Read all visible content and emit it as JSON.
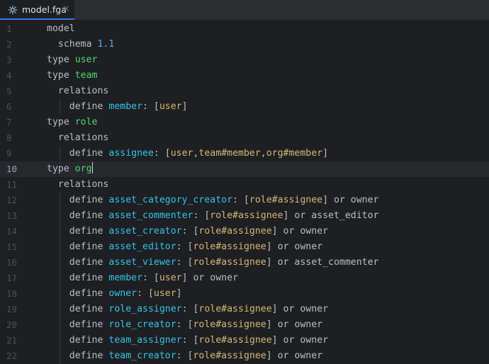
{
  "tab": {
    "label": "model.fga",
    "close": "×",
    "icon": "openfga-model-icon"
  },
  "editor": {
    "current_line": 10,
    "lines": [
      {
        "n": "1",
        "tokens": [
          [
            "kw",
            "model"
          ]
        ],
        "indent": 0
      },
      {
        "n": "2",
        "tokens": [
          [
            "kw",
            "schema "
          ],
          [
            "num",
            "1.1"
          ]
        ],
        "indent": 1
      },
      {
        "n": "3",
        "tokens": [
          [
            "kw",
            "type "
          ],
          [
            "tname",
            "user"
          ]
        ],
        "indent": 0
      },
      {
        "n": "4",
        "tokens": [
          [
            "kw",
            "type "
          ],
          [
            "tname",
            "team"
          ]
        ],
        "indent": 0
      },
      {
        "n": "5",
        "tokens": [
          [
            "kw",
            "relations"
          ]
        ],
        "indent": 1
      },
      {
        "n": "6",
        "tokens": [
          [
            "kw",
            "define "
          ],
          [
            "rel",
            "member"
          ],
          [
            "punct",
            ": ["
          ],
          [
            "ref",
            "user"
          ],
          [
            "punct",
            "]"
          ]
        ],
        "indent": 2
      },
      {
        "n": "7",
        "tokens": [
          [
            "kw",
            "type "
          ],
          [
            "tname",
            "role"
          ]
        ],
        "indent": 0
      },
      {
        "n": "8",
        "tokens": [
          [
            "kw",
            "relations"
          ]
        ],
        "indent": 1
      },
      {
        "n": "9",
        "tokens": [
          [
            "kw",
            "define "
          ],
          [
            "rel",
            "assignee"
          ],
          [
            "punct",
            ": ["
          ],
          [
            "ref",
            "user,team#member,org#member"
          ],
          [
            "punct",
            "]"
          ]
        ],
        "indent": 2
      },
      {
        "n": "10",
        "tokens": [
          [
            "kw",
            "type "
          ],
          [
            "tname",
            "org"
          ]
        ],
        "indent": 0
      },
      {
        "n": "11",
        "tokens": [
          [
            "kw",
            "relations"
          ]
        ],
        "indent": 1
      },
      {
        "n": "12",
        "tokens": [
          [
            "kw",
            "define "
          ],
          [
            "rel",
            "asset_category_creator"
          ],
          [
            "punct",
            ": ["
          ],
          [
            "ref",
            "role#assignee"
          ],
          [
            "punct",
            "] or owner"
          ]
        ],
        "indent": 2
      },
      {
        "n": "13",
        "tokens": [
          [
            "kw",
            "define "
          ],
          [
            "rel",
            "asset_commenter"
          ],
          [
            "punct",
            ": ["
          ],
          [
            "ref",
            "role#assignee"
          ],
          [
            "punct",
            "] or asset_editor"
          ]
        ],
        "indent": 2
      },
      {
        "n": "14",
        "tokens": [
          [
            "kw",
            "define "
          ],
          [
            "rel",
            "asset_creator"
          ],
          [
            "punct",
            ": ["
          ],
          [
            "ref",
            "role#assignee"
          ],
          [
            "punct",
            "] or owner"
          ]
        ],
        "indent": 2
      },
      {
        "n": "15",
        "tokens": [
          [
            "kw",
            "define "
          ],
          [
            "rel",
            "asset_editor"
          ],
          [
            "punct",
            ": ["
          ],
          [
            "ref",
            "role#assignee"
          ],
          [
            "punct",
            "] or owner"
          ]
        ],
        "indent": 2
      },
      {
        "n": "16",
        "tokens": [
          [
            "kw",
            "define "
          ],
          [
            "rel",
            "asset_viewer"
          ],
          [
            "punct",
            ": ["
          ],
          [
            "ref",
            "role#assignee"
          ],
          [
            "punct",
            "] or asset_commenter"
          ]
        ],
        "indent": 2
      },
      {
        "n": "17",
        "tokens": [
          [
            "kw",
            "define "
          ],
          [
            "rel",
            "member"
          ],
          [
            "punct",
            ": ["
          ],
          [
            "ref",
            "user"
          ],
          [
            "punct",
            "] or owner"
          ]
        ],
        "indent": 2
      },
      {
        "n": "18",
        "tokens": [
          [
            "kw",
            "define "
          ],
          [
            "rel",
            "owner"
          ],
          [
            "punct",
            ": ["
          ],
          [
            "ref",
            "user"
          ],
          [
            "punct",
            "]"
          ]
        ],
        "indent": 2
      },
      {
        "n": "19",
        "tokens": [
          [
            "kw",
            "define "
          ],
          [
            "rel",
            "role_assigner"
          ],
          [
            "punct",
            ": ["
          ],
          [
            "ref",
            "role#assignee"
          ],
          [
            "punct",
            "] or owner"
          ]
        ],
        "indent": 2
      },
      {
        "n": "20",
        "tokens": [
          [
            "kw",
            "define "
          ],
          [
            "rel",
            "role_creator"
          ],
          [
            "punct",
            ": ["
          ],
          [
            "ref",
            "role#assignee"
          ],
          [
            "punct",
            "] or owner"
          ]
        ],
        "indent": 2
      },
      {
        "n": "21",
        "tokens": [
          [
            "kw",
            "define "
          ],
          [
            "rel",
            "team_assigner"
          ],
          [
            "punct",
            ": ["
          ],
          [
            "ref",
            "role#assignee"
          ],
          [
            "punct",
            "] or owner"
          ]
        ],
        "indent": 2
      },
      {
        "n": "22",
        "tokens": [
          [
            "kw",
            "define "
          ],
          [
            "rel",
            "team_creator"
          ],
          [
            "punct",
            ": ["
          ],
          [
            "ref",
            "role#assignee"
          ],
          [
            "punct",
            "] or owner"
          ]
        ],
        "indent": 2
      }
    ]
  },
  "colors": {
    "background": "#1e1f22",
    "type_name": "#4fd672",
    "relation": "#33c5e8",
    "reference": "#d5b778",
    "number": "#59a5f2",
    "keyword": "#bcbec4",
    "line_number": "#4b5059"
  }
}
